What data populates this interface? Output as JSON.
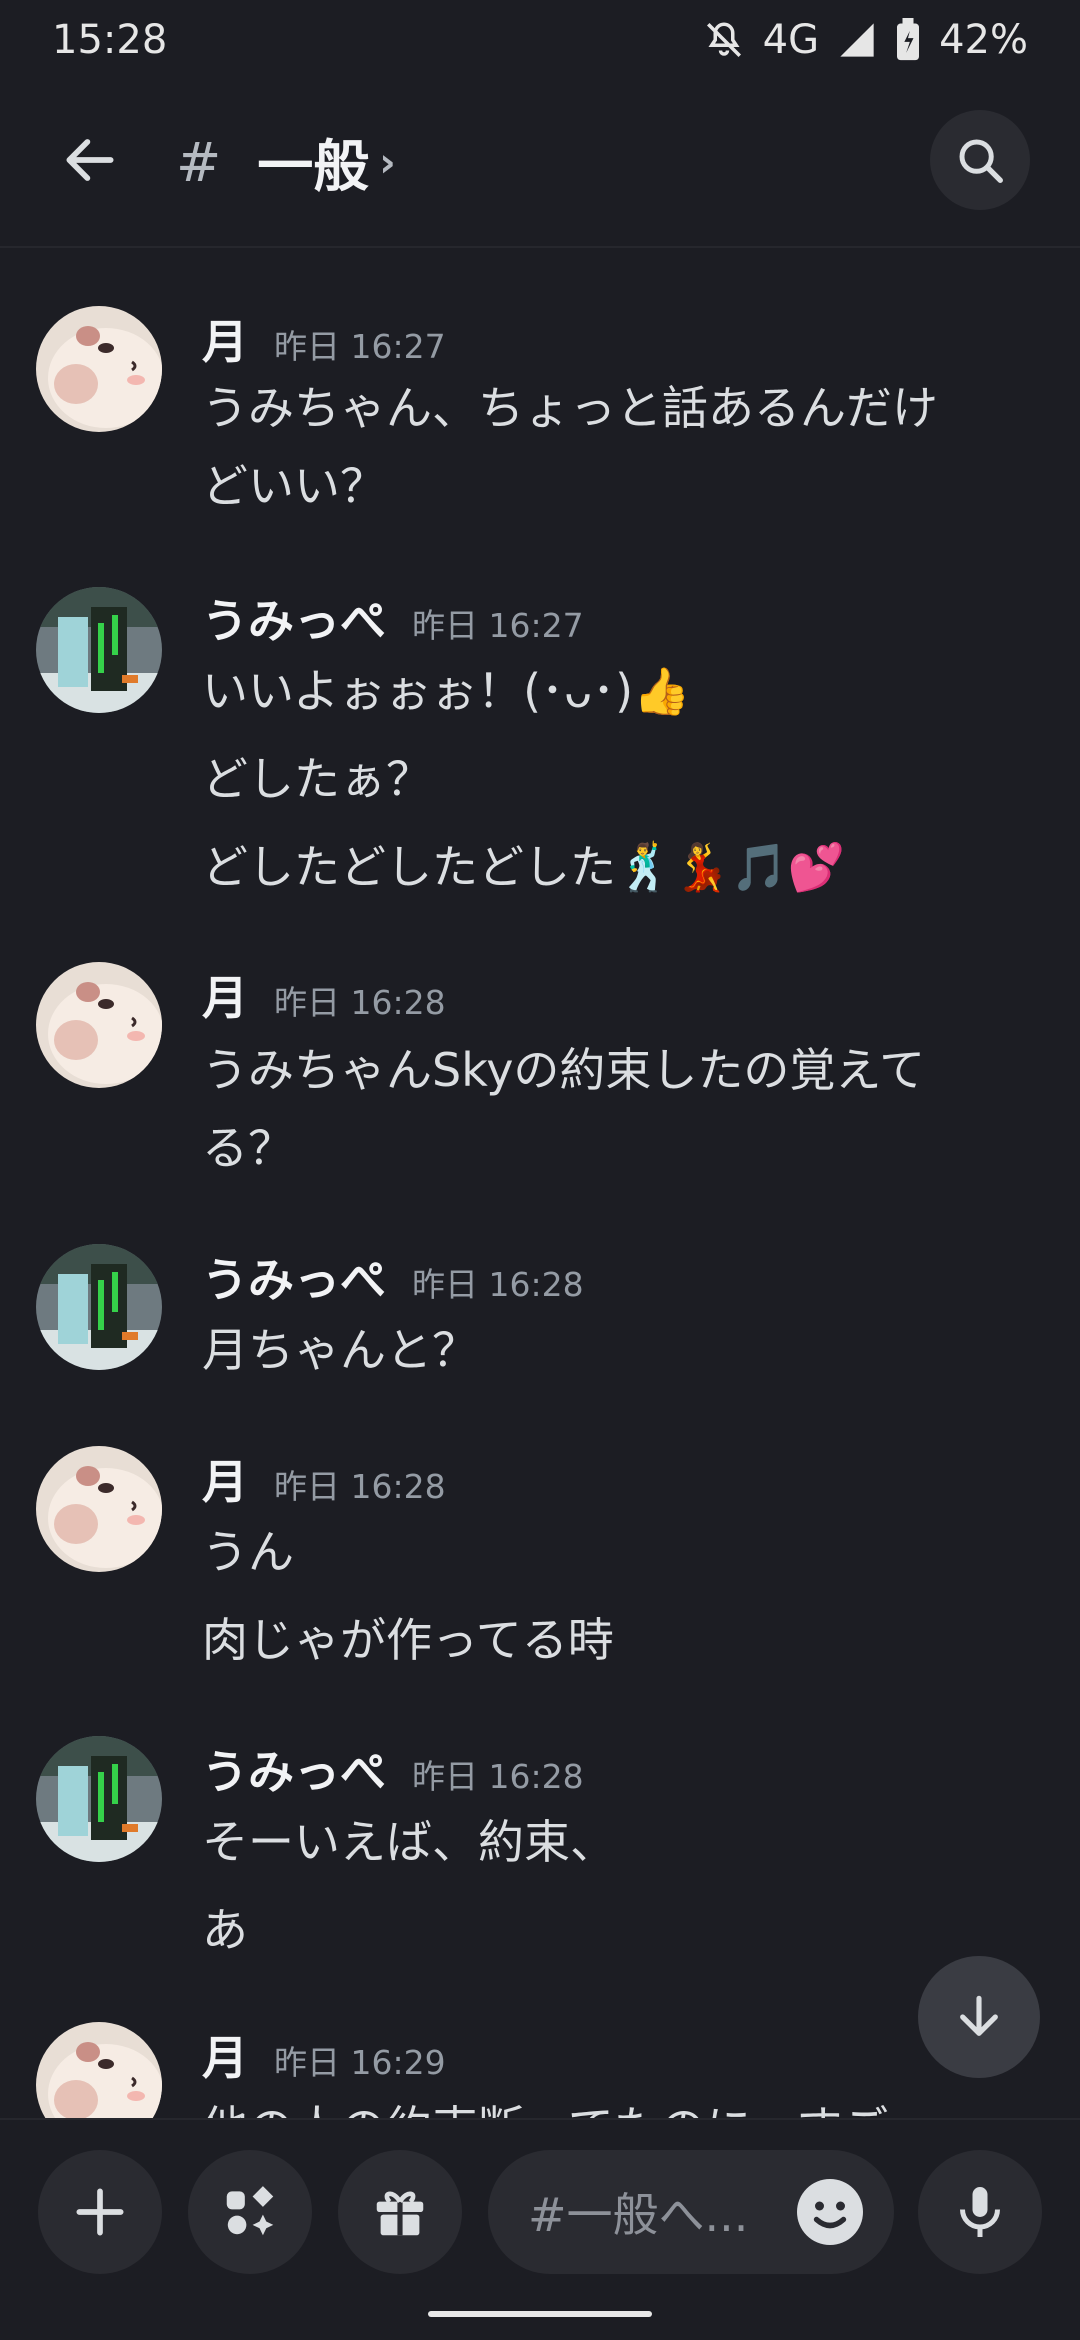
{
  "status_bar": {
    "time": "15:28",
    "network": "4G",
    "battery": "42%",
    "icons": [
      "bell-off-icon",
      "signal-icon",
      "battery-icon"
    ]
  },
  "header": {
    "hash": "#",
    "channel_name": "一般",
    "chevron": "›"
  },
  "messages": [
    {
      "author": "月",
      "time": "昨日 16:27",
      "lines": [
        "うみちゃん、ちょっと話あるんだけ",
        "どいい？"
      ]
    },
    {
      "author": "うみっぺ",
      "time": "昨日 16:27",
      "lines": [
        "いいよぉぉぉ！(･ᴗ･)👍",
        "どしたぁ？",
        "どしたどしたどした🕺💃🎵💕"
      ]
    },
    {
      "author": "月",
      "time": "昨日 16:28",
      "lines": [
        "うみちゃんSkyの約束したの覚えて",
        "る？"
      ]
    },
    {
      "author": "うみっぺ",
      "time": "昨日 16:28",
      "lines": [
        "月ちゃんと？"
      ]
    },
    {
      "author": "月",
      "time": "昨日 16:28",
      "lines": [
        "うん",
        "肉じゃが作ってる時"
      ]
    },
    {
      "author": "うみっぺ",
      "time": "昨日 16:28",
      "lines": [
        "そーいえば、約束、",
        "あ"
      ]
    },
    {
      "author": "月",
      "time": "昨日 16:29",
      "lines": [
        "他の人の約束断ってたのに、すご"
      ]
    }
  ],
  "composer": {
    "placeholder": "#一般へ..."
  },
  "colors": {
    "background": "#1c1d23",
    "surface": "#2a2b31",
    "text": "#dbdee1",
    "muted": "#949ba4"
  }
}
